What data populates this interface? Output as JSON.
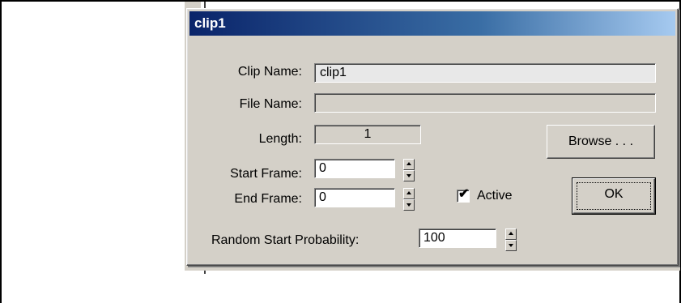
{
  "dialog": {
    "title": "clip1",
    "clip_name_label": "Clip Name:",
    "clip_name_value": "clip1",
    "file_name_label": "File Name:",
    "file_name_value": "",
    "length_label": "Length:",
    "length_value": "1",
    "browse_label": "Browse . . .",
    "start_frame_label": "Start Frame:",
    "start_frame_value": "0",
    "end_frame_label": "End Frame:",
    "end_frame_value": "0",
    "active_label": "Active",
    "active_checked": true,
    "active_mark": "✔",
    "ok_label": "OK",
    "random_start_label": "Random Start Probability:",
    "random_start_value": "100"
  },
  "colors": {
    "title_gradient_start": "#0a246a",
    "title_gradient_end": "#a6caf0",
    "dialog_face": "#d4d0c8"
  }
}
